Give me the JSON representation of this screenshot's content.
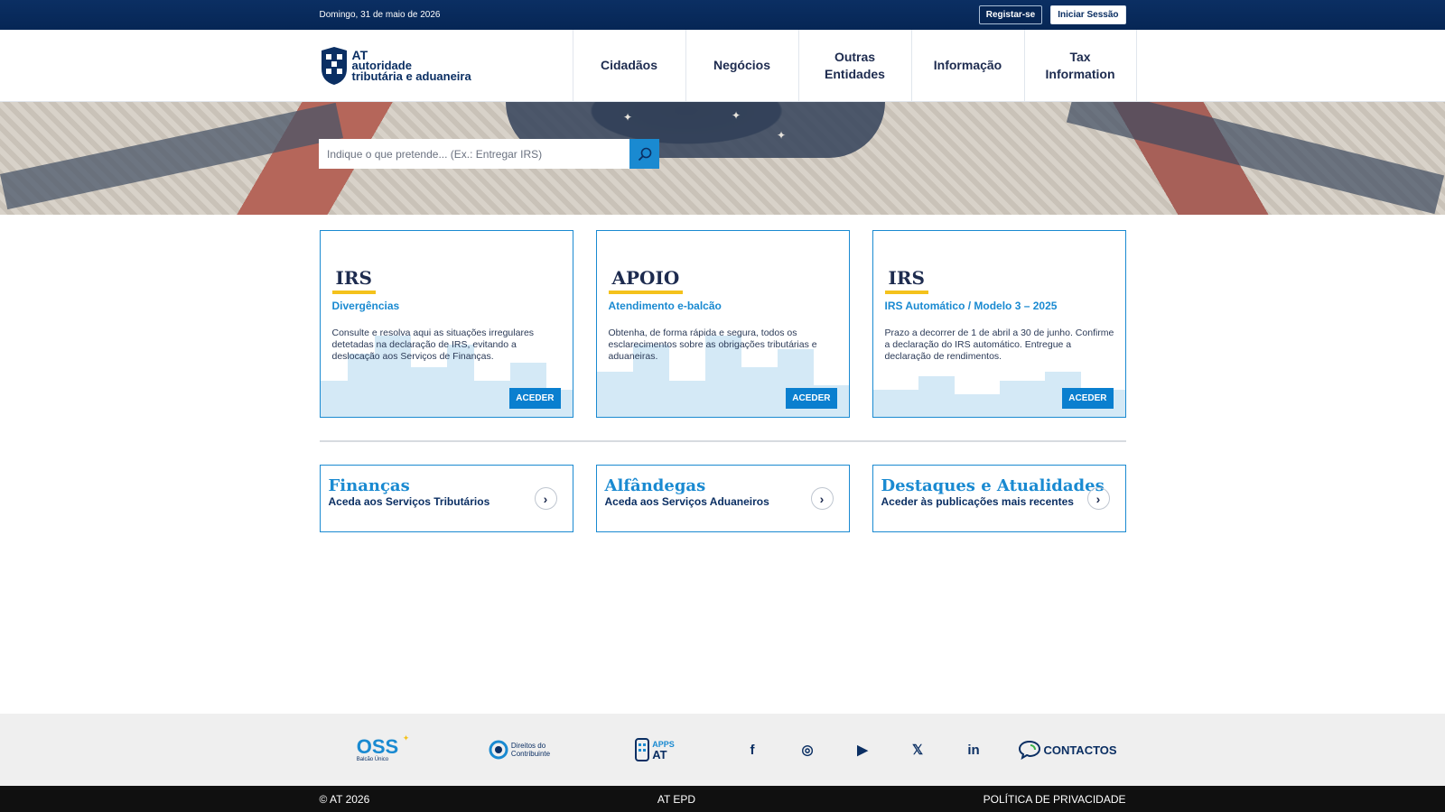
{
  "topbar": {
    "date": "Domingo, 31 de maio de 2026",
    "register_label": "Registar-se",
    "login_label": "Iniciar Sessão"
  },
  "logo": {
    "line1": "AT",
    "line2": "autoridade",
    "line3": "tributária e aduaneira"
  },
  "nav": {
    "items": [
      {
        "label": "Cidadãos"
      },
      {
        "label": "Negócios"
      },
      {
        "label": "Outras Entidades"
      },
      {
        "label": "Informação"
      },
      {
        "label": "Tax Information"
      }
    ]
  },
  "search": {
    "placeholder": "Indique o que pretende... (Ex.: Entregar IRS)"
  },
  "cards": [
    {
      "tag": "IRS",
      "subtitle": "Divergências",
      "text": "Consulte e resolva aqui as situações irregulares detetadas na declaração de IRS, evitando a deslocação aos Serviços de Finanças.",
      "button": "ACEDER"
    },
    {
      "tag": "APOIO",
      "subtitle": "Atendimento e-balcão",
      "text": "Obtenha, de forma rápida e segura, todos os esclarecimentos sobre as obrigações tributárias e aduaneiras.",
      "button": "ACEDER"
    },
    {
      "tag": "IRS",
      "subtitle": "IRS Automático / Modelo 3 – 2025",
      "text": "Prazo a decorrer de 1 de abril a 30 de junho. Confirme a declaração do IRS automático. Entregue a declaração de rendimentos.",
      "button": "ACEDER"
    }
  ],
  "links": [
    {
      "title": "Finanças",
      "subtitle": "Aceda aos Serviços Tributários"
    },
    {
      "title": "Alfândegas",
      "subtitle": "Aceda aos Serviços Aduaneiros"
    },
    {
      "title": "Destaques e Atualidades",
      "subtitle": "Aceder às publicações mais recentes"
    }
  ],
  "footer": {
    "oss_label": "OSS",
    "oss_sub": "Balcão Único",
    "rights_line1": "Direitos do",
    "rights_line2": "Contribuinte",
    "apps_line1": "APPS",
    "apps_line2": "AT",
    "social": {
      "facebook": "f",
      "instagram": "◎",
      "youtube": "▶",
      "x": "𝕏",
      "linkedin": "in"
    },
    "contacts_label": "CONTACTOS"
  },
  "bottombar": {
    "copyright": "© AT 2026",
    "epd": "AT EPD",
    "privacy": "POLÍTICA DE PRIVACIDADE"
  },
  "colors": {
    "brand_blue": "#1a8ad1",
    "navy": "#0b2f63",
    "accent_yellow": "#f4c21c"
  }
}
